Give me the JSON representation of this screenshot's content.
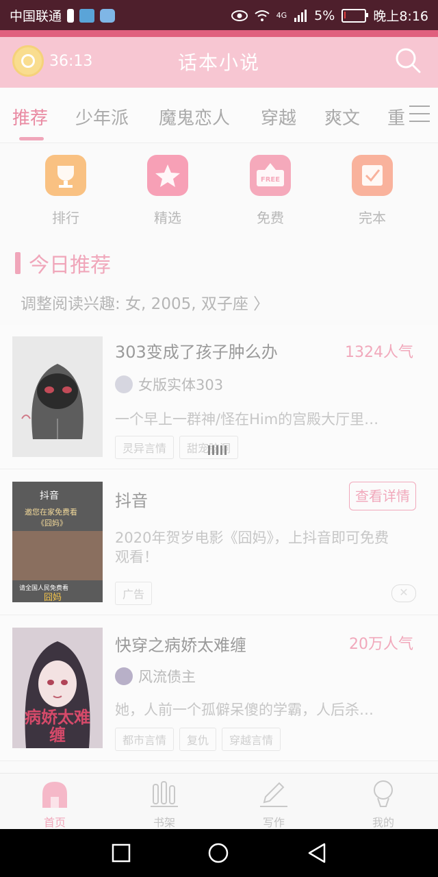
{
  "status_bar": {
    "carrier": "中国联通",
    "network": "4G",
    "battery_pct": "5%",
    "battery_level": 0.05,
    "time": "晚上8:16"
  },
  "header": {
    "timer": "36:13",
    "title": "话本小说"
  },
  "tabs": [
    "推荐",
    "少年派",
    "魔鬼恋人",
    "穿越",
    "爽文",
    "重"
  ],
  "quick_links": [
    {
      "label": "排行",
      "icon": "trophy-icon",
      "color": "#f9c182"
    },
    {
      "label": "精选",
      "icon": "star-icon",
      "color": "#f7a0b6"
    },
    {
      "label": "免费",
      "icon": "free-icon",
      "color": "#f5a9bb",
      "badge": "FREE"
    },
    {
      "label": "完本",
      "icon": "checkbox-icon",
      "color": "#f9b29c"
    }
  ],
  "section": {
    "title": "今日推荐",
    "interest": "调整阅读兴趣: 女, 2005, 双子座 〉"
  },
  "books": [
    {
      "title": "303变成了孩子肿么办",
      "popularity": "1324人气",
      "author": "女版实体303",
      "desc": "一个早上一群神/怪在Him的宫殿大厅里…",
      "tags": [
        "灵异言情",
        "甜宠脑洞"
      ]
    },
    {
      "title": "抖音",
      "button": "查看详情",
      "desc_line1": "2020年贺岁电影《囧妈》，上抖音即可免费",
      "desc_line2": "观看！",
      "tag": "广告",
      "close": "✕",
      "cover": {
        "brand": "抖音",
        "line1": "邀您在家免费看",
        "line2": "《囧妈》",
        "line3": "请全国人民免费看",
        "line4": "囧妈"
      }
    },
    {
      "title": "快穿之病娇太难缠",
      "popularity": "20万人气",
      "author": "风流债主",
      "desc": "她，人前一个孤僻呆傻的学霸，人后杀…",
      "tags": [
        "都市言情",
        "复仇",
        "穿越言情"
      ],
      "cover_text": "病娇太难缠"
    }
  ],
  "bottom_nav": [
    {
      "label": "首页",
      "icon": "home-icon",
      "active": true
    },
    {
      "label": "书架",
      "icon": "bookshelf-icon",
      "active": false
    },
    {
      "label": "写作",
      "icon": "pen-icon",
      "active": false
    },
    {
      "label": "我的",
      "icon": "profile-icon",
      "active": false
    }
  ],
  "colors": {
    "accent": "#f1a8bb",
    "header": "#f7c6d2",
    "status_bar": "#4e1f2c"
  }
}
